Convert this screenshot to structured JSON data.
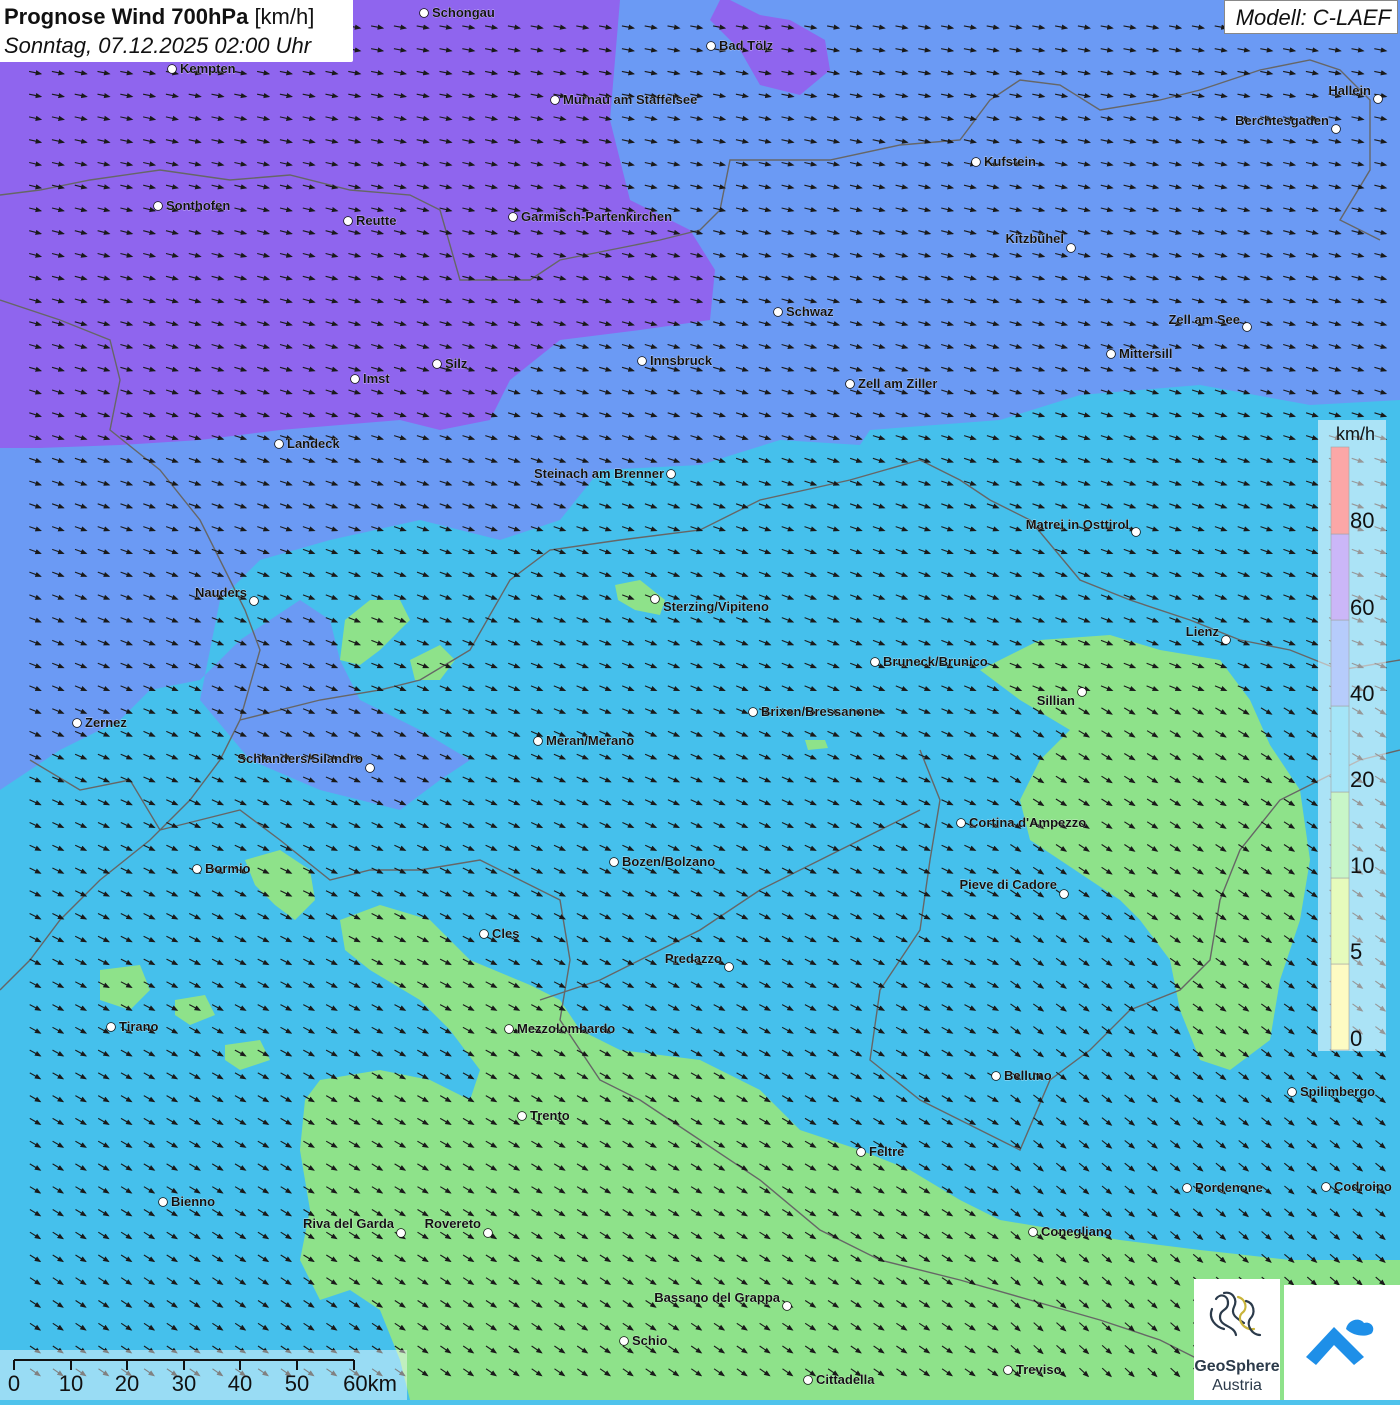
{
  "header": {
    "title_bold": "Prognose Wind 700hPa",
    "title_unit": "[km/h]",
    "datetime": "Sonntag, 07.12.2025 02:00 Uhr",
    "model": "Modell: C-LAEF"
  },
  "legend": {
    "unit": "km/h",
    "classes": [
      {
        "label": "0",
        "color": "#fbf77a"
      },
      {
        "label": "5",
        "color": "#c8f56c"
      },
      {
        "label": "10",
        "color": "#86eb86"
      },
      {
        "label": "20",
        "color": "#38c6f0"
      },
      {
        "label": "40",
        "color": "#5d8ff5"
      },
      {
        "label": "60",
        "color": "#8c5ff0"
      },
      {
        "label": "80",
        "color": "#f53c3c"
      }
    ]
  },
  "scale_bar": {
    "labels": [
      "0",
      "10",
      "20",
      "30",
      "40",
      "50",
      "60km"
    ]
  },
  "cities": [
    {
      "name": "Schongau"
    },
    {
      "name": "Bad Tölz"
    },
    {
      "name": "Kempten"
    },
    {
      "name": "Murnau am Staffelsee"
    },
    {
      "name": "Hallein"
    },
    {
      "name": "Berchtesgaden"
    },
    {
      "name": "Kufstein"
    },
    {
      "name": "Sonthofen"
    },
    {
      "name": "Reutte"
    },
    {
      "name": "Garmisch-Partenkirchen"
    },
    {
      "name": "Kitzbühel"
    },
    {
      "name": "Schwaz"
    },
    {
      "name": "Zell am See"
    },
    {
      "name": "Mittersill"
    },
    {
      "name": "Innsbruck"
    },
    {
      "name": "Silz"
    },
    {
      "name": "Imst"
    },
    {
      "name": "Zell am Ziller"
    },
    {
      "name": "Landeck"
    },
    {
      "name": "Steinach am Brenner"
    },
    {
      "name": "Matrei in Osttirol"
    },
    {
      "name": "Nauders"
    },
    {
      "name": "Sterzing/Vipiteno"
    },
    {
      "name": "Lienz"
    },
    {
      "name": "Bruneck/Brunico"
    },
    {
      "name": "Sillian"
    },
    {
      "name": "Zernez"
    },
    {
      "name": "Brixen/Bressanone"
    },
    {
      "name": "Meran/Merano"
    },
    {
      "name": "Schlanders/Silandro"
    },
    {
      "name": "Cortina d'Ampezzo"
    },
    {
      "name": "Bozen/Bolzano"
    },
    {
      "name": "Bormio"
    },
    {
      "name": "Pieve di Cadore"
    },
    {
      "name": "Cles"
    },
    {
      "name": "Predazzo"
    },
    {
      "name": "Tirano"
    },
    {
      "name": "Mezzolombardo"
    },
    {
      "name": "Belluno"
    },
    {
      "name": "Spilimbergo"
    },
    {
      "name": "Trento"
    },
    {
      "name": "Feltre"
    },
    {
      "name": "Pordenone"
    },
    {
      "name": "Codroipo"
    },
    {
      "name": "Bienno"
    },
    {
      "name": "Riva del Garda"
    },
    {
      "name": "Rovereto"
    },
    {
      "name": "Conegliano"
    },
    {
      "name": "Bassano del Grappa"
    },
    {
      "name": "Schio"
    },
    {
      "name": "Treviso"
    },
    {
      "name": "Cittadella"
    }
  ],
  "logos": {
    "geosphere_line1": "GeoSphere",
    "geosphere_line2": "Austria"
  }
}
